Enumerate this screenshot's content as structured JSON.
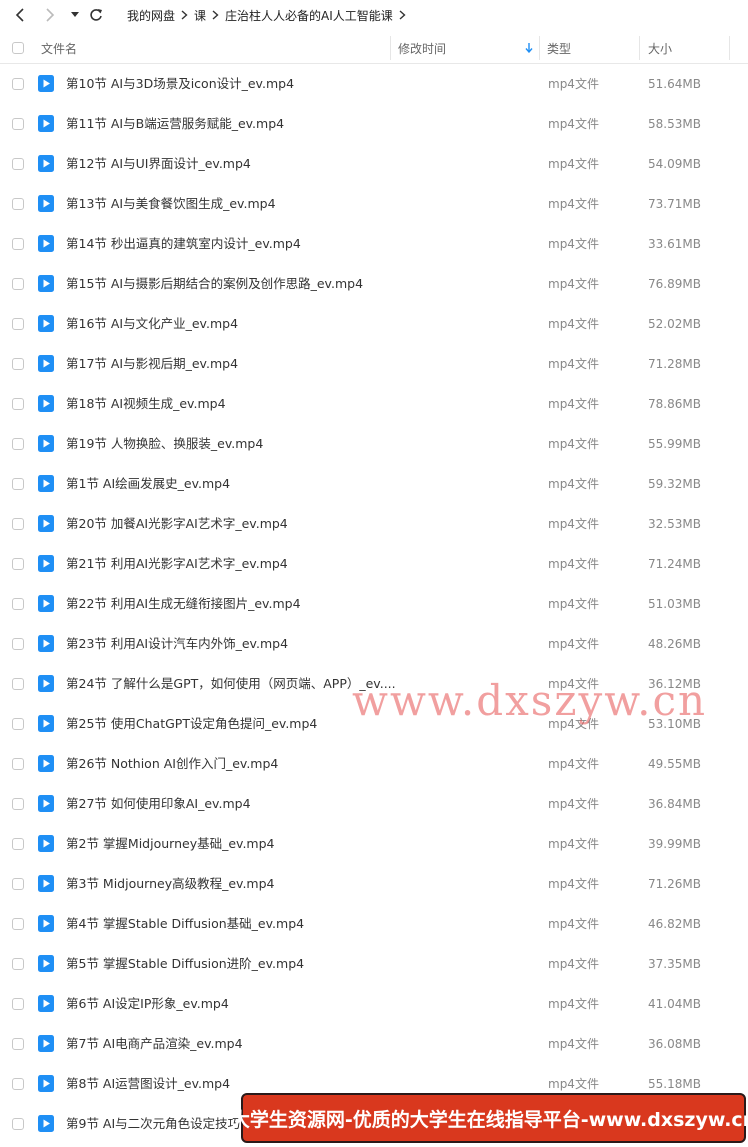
{
  "breadcrumb": [
    "我的网盘",
    "课",
    "庄治柱人人必备的AI人工智能课"
  ],
  "columns": {
    "name": "文件名",
    "modified": "修改时间",
    "type": "类型",
    "size": "大小"
  },
  "files": [
    {
      "name": "第10节 AI与3D场景及icon设计_ev.mp4",
      "type": "mp4文件",
      "size": "51.64MB"
    },
    {
      "name": "第11节 AI与B端运营服务赋能_ev.mp4",
      "type": "mp4文件",
      "size": "58.53MB"
    },
    {
      "name": "第12节 AI与UI界面设计_ev.mp4",
      "type": "mp4文件",
      "size": "54.09MB"
    },
    {
      "name": "第13节 AI与美食餐饮图生成_ev.mp4",
      "type": "mp4文件",
      "size": "73.71MB"
    },
    {
      "name": "第14节 秒出逼真的建筑室内设计_ev.mp4",
      "type": "mp4文件",
      "size": "33.61MB"
    },
    {
      "name": "第15节 AI与摄影后期结合的案例及创作思路_ev.mp4",
      "type": "mp4文件",
      "size": "76.89MB"
    },
    {
      "name": "第16节 AI与文化产业_ev.mp4",
      "type": "mp4文件",
      "size": "52.02MB"
    },
    {
      "name": "第17节 AI与影视后期_ev.mp4",
      "type": "mp4文件",
      "size": "71.28MB"
    },
    {
      "name": "第18节 AI视频生成_ev.mp4",
      "type": "mp4文件",
      "size": "78.86MB"
    },
    {
      "name": "第19节 人物换脸、换服装_ev.mp4",
      "type": "mp4文件",
      "size": "55.99MB"
    },
    {
      "name": "第1节 AI绘画发展史_ev.mp4",
      "type": "mp4文件",
      "size": "59.32MB"
    },
    {
      "name": "第20节 加餐AI光影字AI艺术字_ev.mp4",
      "type": "mp4文件",
      "size": "32.53MB"
    },
    {
      "name": "第21节 利用AI光影字AI艺术字_ev.mp4",
      "type": "mp4文件",
      "size": "71.24MB"
    },
    {
      "name": "第22节 利用AI生成无缝衔接图片_ev.mp4",
      "type": "mp4文件",
      "size": "51.03MB"
    },
    {
      "name": "第23节 利用AI设计汽车内外饰_ev.mp4",
      "type": "mp4文件",
      "size": "48.26MB"
    },
    {
      "name": "第24节 了解什么是GPT，如何使用（网页端、APP）_ev....",
      "type": "mp4文件",
      "size": "36.12MB"
    },
    {
      "name": "第25节 使用ChatGPT设定角色提问_ev.mp4",
      "type": "mp4文件",
      "size": "53.10MB"
    },
    {
      "name": "第26节 Nothion AI创作入门_ev.mp4",
      "type": "mp4文件",
      "size": "49.55MB"
    },
    {
      "name": "第27节 如何使用印象AI_ev.mp4",
      "type": "mp4文件",
      "size": "36.84MB"
    },
    {
      "name": "第2节 掌握Midjourney基础_ev.mp4",
      "type": "mp4文件",
      "size": "39.99MB"
    },
    {
      "name": "第3节 Midjourney高级教程_ev.mp4",
      "type": "mp4文件",
      "size": "71.26MB"
    },
    {
      "name": "第4节 掌握Stable Diffusion基础_ev.mp4",
      "type": "mp4文件",
      "size": "46.82MB"
    },
    {
      "name": "第5节 掌握Stable Diffusion进阶_ev.mp4",
      "type": "mp4文件",
      "size": "37.35MB"
    },
    {
      "name": "第6节 AI设定IP形象_ev.mp4",
      "type": "mp4文件",
      "size": "41.04MB"
    },
    {
      "name": "第7节 AI电商产品渲染_ev.mp4",
      "type": "mp4文件",
      "size": "36.08MB"
    },
    {
      "name": "第8节 AI运营图设计_ev.mp4",
      "type": "mp4文件",
      "size": "55.18MB"
    },
    {
      "name": "第9节 AI与二次元角色设定技巧",
      "type": "",
      "size": ""
    }
  ],
  "watermark": "www.dxszyw.cn",
  "banner": "大学生资源网-优质的大学生在线指导平台-www.dxszyw.cn",
  "colors": {
    "file_icon": "#1f8ff5",
    "banner_bg": "#d9381e",
    "watermark": "#e65050"
  }
}
